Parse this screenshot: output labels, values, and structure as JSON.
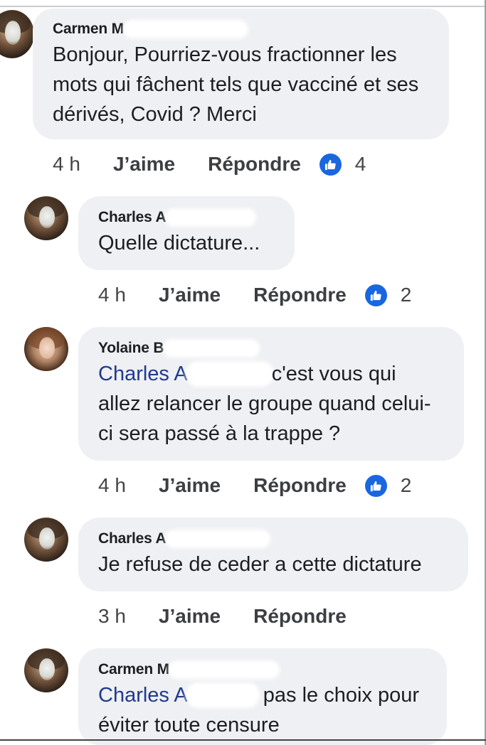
{
  "comments": [
    {
      "author": "Carmen M",
      "text": "Bonjour, Pourriez-vous fractionner les mots qui fâchent tels que vacciné et ses dérivés, Covid ? Merci",
      "time": "4 h",
      "like": "J’aime",
      "reply": "Répondre",
      "reactions": "4"
    },
    {
      "author": "Charles A",
      "text": "Quelle dictature...",
      "time": "4 h",
      "like": "J’aime",
      "reply": "Répondre",
      "reactions": "2"
    },
    {
      "author": "Yolaine B",
      "mention": "Charles A",
      "text": "c'est vous qui allez relancer le groupe quand celui-ci sera passé à la trappe ?",
      "time": "4 h",
      "like": "J’aime",
      "reply": "Répondre",
      "reactions": "2"
    },
    {
      "author": "Charles A",
      "text": "Je refuse de ceder a cette dictature",
      "time": "3 h",
      "like": "J’aime",
      "reply": "Répondre"
    },
    {
      "author": "Carmen M",
      "mention": "Charles A",
      "text": "pas le choix pour éviter toute censure"
    }
  ],
  "icons": {
    "reaction": "like-thumb-icon"
  },
  "colors": {
    "bubble": "#eff0f3",
    "mention": "#203a8c",
    "reaction": "#1a66e0"
  }
}
